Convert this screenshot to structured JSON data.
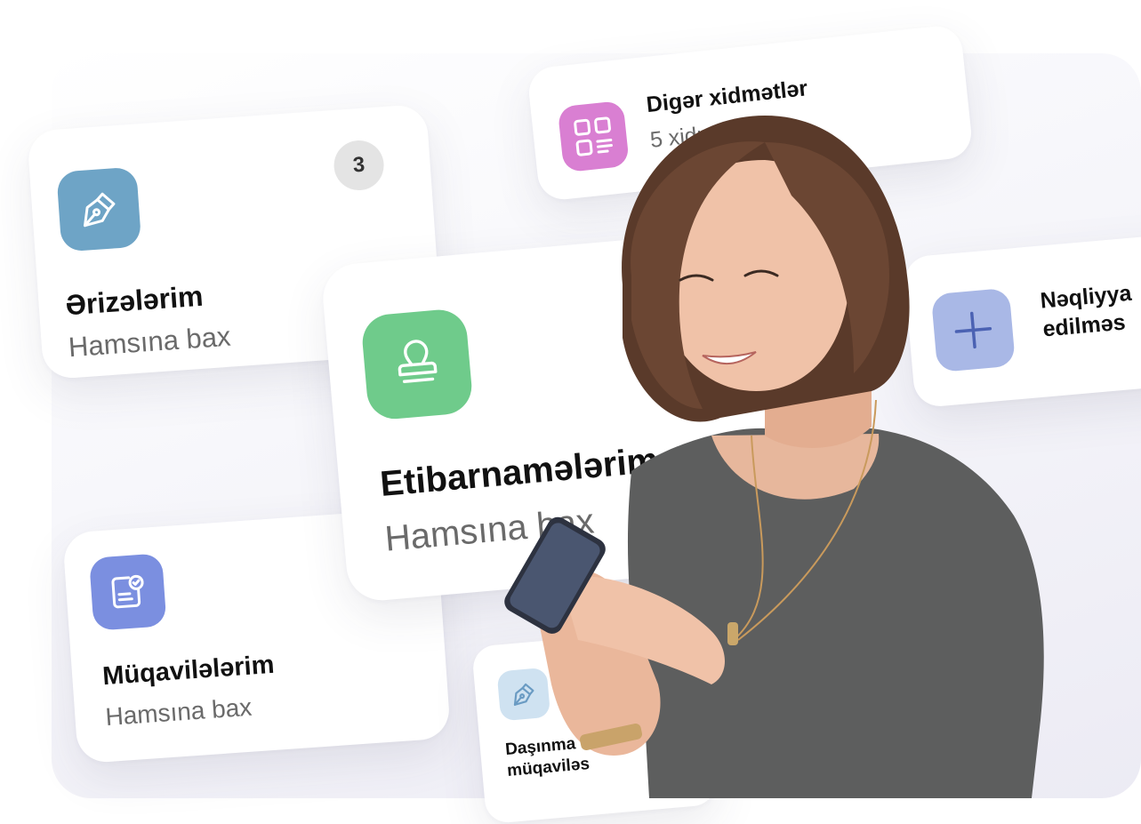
{
  "cards": {
    "arizalerim": {
      "title": "Ərizələrim",
      "link": "Hamsına bax",
      "badge": "3",
      "color": "#6ea4c6"
    },
    "etibarnamalarim": {
      "title": "Etibarnamələrim",
      "link": "Hamsına bax",
      "color": "#6fcb8b"
    },
    "muqavilalarim": {
      "title": "Müqavilələrim",
      "link": "Hamsına bax",
      "color": "#7b8fe0"
    },
    "diger": {
      "title": "Digər xidmətlər",
      "link": "5 xidmət",
      "color": "#d97fd2"
    },
    "naqliyyat": {
      "title_line1": "Nəqliyya",
      "title_line2": "edilməs",
      "color": "#a9b8e6"
    },
    "dasinmaz": {
      "title_line1": "Daşınma",
      "title_line2": "müqaviləs",
      "color": "#cfe2f1"
    }
  }
}
